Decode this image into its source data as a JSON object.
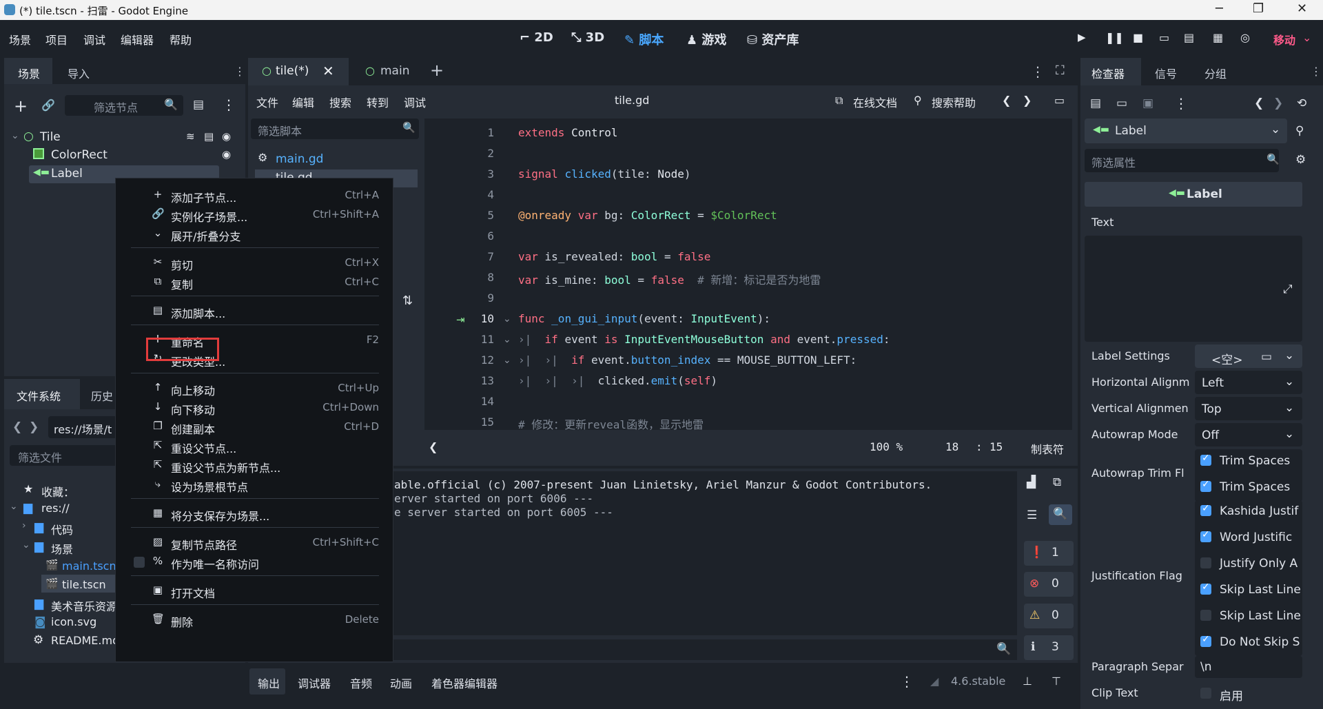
{
  "window": {
    "title": "(*) tile.tscn - 扫雷 - Godot Engine"
  },
  "menu": [
    "场景",
    "项目",
    "调试",
    "编辑器",
    "帮助"
  ],
  "modes": [
    "2D",
    "3D",
    "脚本",
    "游戏",
    "资产库"
  ],
  "run_label": "移动",
  "scene_dock": {
    "tabs": [
      "场景",
      "导入"
    ],
    "filter_placeholder": "筛选节点",
    "nodes": [
      "Tile",
      "ColorRect",
      "Label"
    ]
  },
  "fs_dock": {
    "tabs": [
      "文件系统",
      "历史"
    ],
    "path": "res://场景/t",
    "filter_placeholder": "筛选文件",
    "items": [
      "收藏：",
      "res://",
      "代码",
      "场景",
      "main.tscn",
      "tile.tscn",
      "美术音乐资源",
      "icon.svg",
      "README.md"
    ]
  },
  "editor": {
    "tabs": [
      "tile(*)",
      "main"
    ],
    "menu": [
      "文件",
      "编辑",
      "搜索",
      "转到",
      "调试"
    ],
    "filename": "tile.gd",
    "online_docs": "在线文档",
    "search_help": "搜索帮助",
    "script_filter": "筛选脚本",
    "scripts": [
      "main.gd",
      "tile.gd"
    ],
    "zoom": "100 %",
    "line": "18",
    "col": "15",
    "indent": "制表符",
    "lines": [
      "1",
      "2",
      "3",
      "4",
      "5",
      "6",
      "7",
      "8",
      "9",
      "10",
      "11",
      "12",
      "13",
      "14",
      "15"
    ]
  },
  "output": {
    "lines": [
      "able.official (c) 2007-present Juan Linietsky, Ariel Manzur & Godot Contributors.",
      "erver started on port 6006 ---",
      "e server started on port 6005 ---"
    ],
    "counts": [
      "1",
      "0",
      "0",
      "3"
    ]
  },
  "bottom_tabs": [
    "输出",
    "调试器",
    "音频",
    "动画",
    "着色器编辑器"
  ],
  "version": "4.6.stable",
  "inspector": {
    "tabs": [
      "检查器",
      "信号",
      "分组"
    ],
    "node": "Label",
    "filter_placeholder": "筛选属性",
    "header": "Label",
    "text_label": "Text",
    "props": [
      {
        "k": "Label Settings",
        "v": "<空>"
      },
      {
        "k": "Horizontal Alignm",
        "v": "Left"
      },
      {
        "k": "Vertical Alignmen",
        "v": "Top"
      },
      {
        "k": "Autowrap Mode",
        "v": "Off"
      },
      {
        "k": "Autowrap Trim Fl",
        "v": ""
      },
      {
        "k": "Justification Flag",
        "v": ""
      },
      {
        "k": "Paragraph Separ",
        "v": "\\n"
      },
      {
        "k": "Clip Text",
        "v": "启用"
      }
    ],
    "trim": [
      "Trim Spaces",
      "Trim Spaces"
    ],
    "just": [
      "Kashida Justif",
      "Word Justific",
      "Justify Only A",
      "Skip Last Line",
      "Skip Last Line",
      "Do Not Skip S"
    ]
  },
  "context_menu": [
    {
      "label": "添加子节点...",
      "shortcut": "Ctrl+A",
      "icon": "+"
    },
    {
      "label": "实例化子场景...",
      "shortcut": "Ctrl+Shift+A",
      "icon": "🔗"
    },
    {
      "label": "展开/折叠分支",
      "shortcut": "",
      "icon": "⌄"
    },
    {
      "label": "剪切",
      "shortcut": "Ctrl+X",
      "icon": "✂"
    },
    {
      "label": "复制",
      "shortcut": "Ctrl+C",
      "icon": "⧉"
    },
    {
      "label": "添加脚本...",
      "shortcut": "",
      "icon": "▤"
    },
    {
      "label": "重命名",
      "shortcut": "F2",
      "icon": "I"
    },
    {
      "label": "更改类型...",
      "shortcut": "",
      "icon": "↻"
    },
    {
      "label": "向上移动",
      "shortcut": "Ctrl+Up",
      "icon": "↑"
    },
    {
      "label": "向下移动",
      "shortcut": "Ctrl+Down",
      "icon": "↓"
    },
    {
      "label": "创建副本",
      "shortcut": "Ctrl+D",
      "icon": "❐"
    },
    {
      "label": "重设父节点...",
      "shortcut": "",
      "icon": "⇱"
    },
    {
      "label": "重设父节点为新节点...",
      "shortcut": "",
      "icon": "⇱"
    },
    {
      "label": "设为场景根节点",
      "shortcut": "",
      "icon": "⤷"
    },
    {
      "label": "将分支保存为场景...",
      "shortcut": "",
      "icon": "▦"
    },
    {
      "label": "复制节点路径",
      "shortcut": "Ctrl+Shift+C",
      "icon": "▨"
    },
    {
      "label": "作为唯一名称访问",
      "shortcut": "",
      "icon": "%"
    },
    {
      "label": "打开文档",
      "shortcut": "",
      "icon": "▣"
    },
    {
      "label": "删除",
      "shortcut": "Delete",
      "icon": "🗑"
    }
  ]
}
